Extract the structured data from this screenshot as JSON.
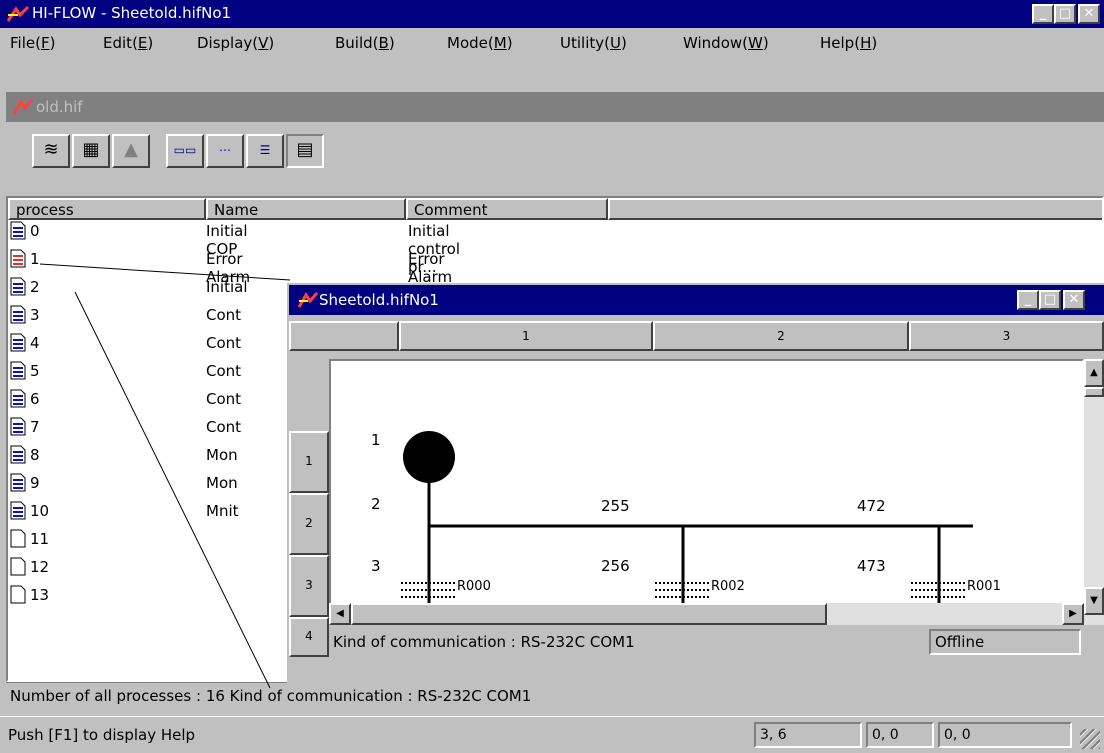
{
  "app": {
    "title": "HI-FLOW - Sheetold.hifNo1"
  },
  "menu": [
    {
      "label": "File",
      "key": "F"
    },
    {
      "label": "Edit",
      "key": "E"
    },
    {
      "label": "Display",
      "key": "V"
    },
    {
      "label": "Build",
      "key": "B"
    },
    {
      "label": "Mode",
      "key": "M"
    },
    {
      "label": "Utility",
      "key": "U"
    },
    {
      "label": "Window",
      "key": "W"
    },
    {
      "label": "Help",
      "key": "H"
    }
  ],
  "doc": {
    "title": "old.hif",
    "columns": [
      "process",
      "Name",
      "Comment"
    ],
    "rows": [
      {
        "num": "0",
        "name": "Initial COP",
        "comment": "Initial control pr..."
      },
      {
        "num": "1",
        "name": "Error Alarm",
        "comment": "Error Alarm an..."
      },
      {
        "num": "2",
        "name": "Initial",
        "comment": ""
      },
      {
        "num": "3",
        "name": "Cont",
        "comment": ""
      },
      {
        "num": "4",
        "name": "Cont",
        "comment": ""
      },
      {
        "num": "5",
        "name": "Cont",
        "comment": ""
      },
      {
        "num": "6",
        "name": "Cont",
        "comment": ""
      },
      {
        "num": "7",
        "name": "Cont",
        "comment": ""
      },
      {
        "num": "8",
        "name": "Mon",
        "comment": ""
      },
      {
        "num": "9",
        "name": "Mon",
        "comment": ""
      },
      {
        "num": "10",
        "name": "Mnit",
        "comment": ""
      },
      {
        "num": "11",
        "name": "",
        "comment": ""
      },
      {
        "num": "12",
        "name": "",
        "comment": ""
      },
      {
        "num": "13",
        "name": "",
        "comment": ""
      }
    ],
    "status": "Number of all processes : 16  Kind of communication : RS-232C COM1"
  },
  "sheet": {
    "title": "Sheetold.hifNo1",
    "col_headers": [
      "1",
      "2",
      "3"
    ],
    "row_headers": [
      "1",
      "2",
      "3",
      "4"
    ],
    "step_labels": [
      "1",
      "2",
      "3"
    ],
    "branch_numbers": [
      "255",
      "472",
      "256",
      "473"
    ],
    "relays": [
      "R000",
      "R002",
      "R001"
    ],
    "comm": "Kind of communication : RS-232C COM1",
    "state": "Offline"
  },
  "statusbar": {
    "help": "Push [F1] to display Help",
    "pos": "3, 6",
    "c1": "0, 0",
    "c2": "0, 0"
  }
}
